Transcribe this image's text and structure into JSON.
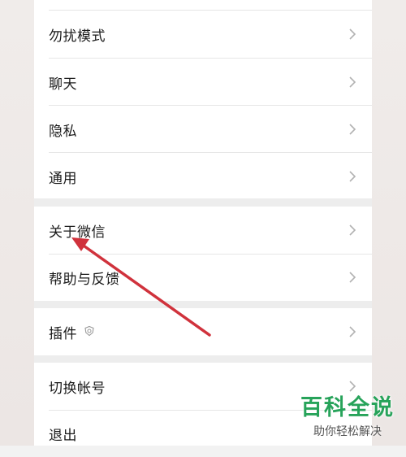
{
  "settings": {
    "group1": [
      {
        "label": "勿扰模式"
      },
      {
        "label": "聊天"
      },
      {
        "label": "隐私"
      },
      {
        "label": "通用"
      }
    ],
    "group2": [
      {
        "label": "关于微信"
      },
      {
        "label": "帮助与反馈"
      }
    ],
    "group3": [
      {
        "label": "插件"
      }
    ],
    "group4": [
      {
        "label": "切换帐号"
      },
      {
        "label": "退出"
      }
    ]
  },
  "watermark": {
    "title": "百科全说",
    "subtitle": "助你轻松解决"
  },
  "colors": {
    "annotation_arrow": "#d0323c",
    "watermark_green": "#27a35a"
  }
}
